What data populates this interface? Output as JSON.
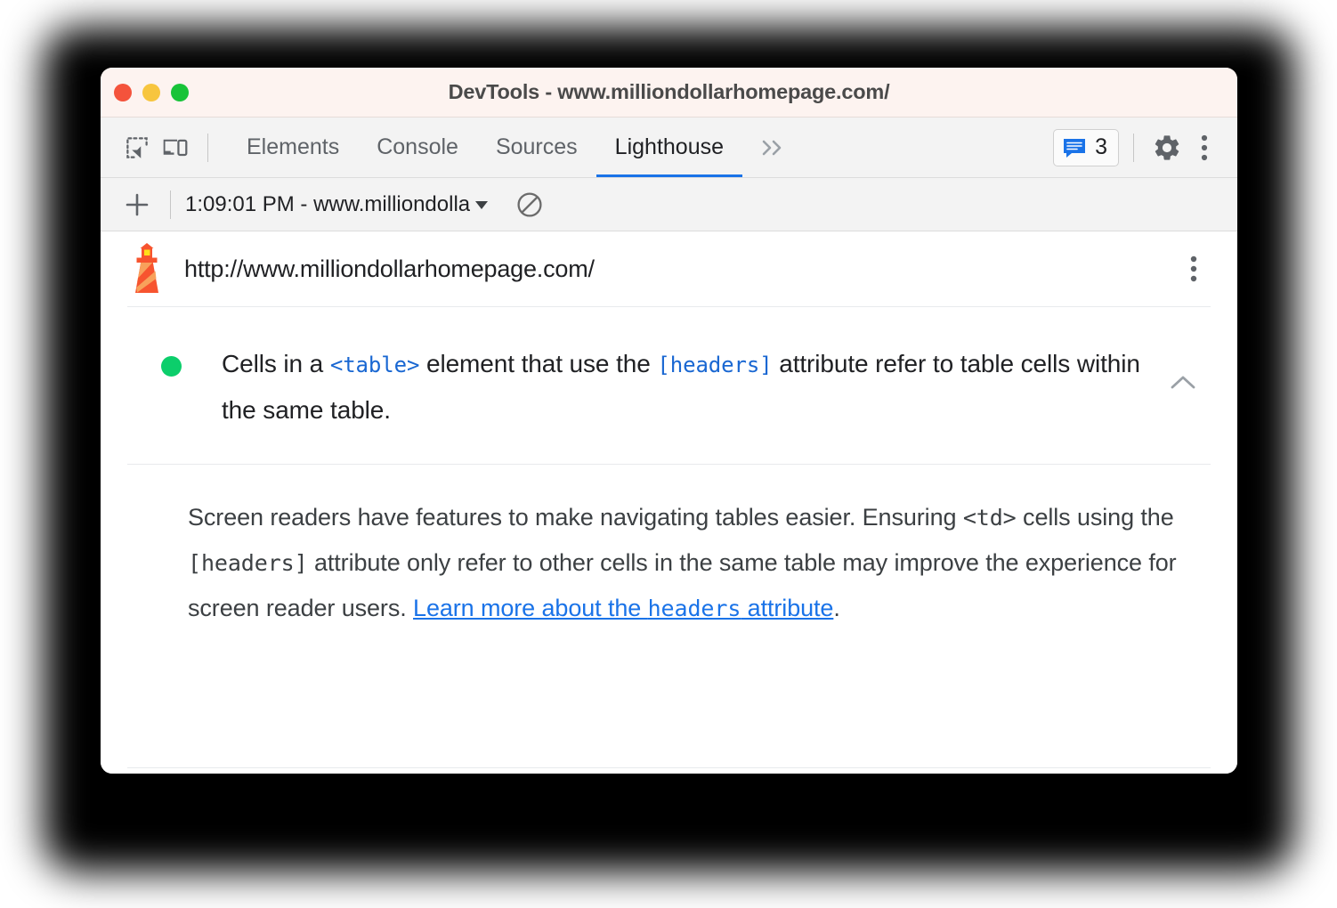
{
  "window": {
    "title": "DevTools - www.milliondollarhomepage.com/",
    "traffic_lights": [
      {
        "name": "close",
        "color": "#f4533c"
      },
      {
        "name": "minimize",
        "color": "#f7c53f"
      },
      {
        "name": "maximize",
        "color": "#18c339"
      }
    ]
  },
  "toolbar": {
    "inspect_icon": "inspect-element-icon",
    "device_icon": "device-toolbar-icon",
    "tabs": [
      {
        "label": "Elements",
        "active": false
      },
      {
        "label": "Console",
        "active": false
      },
      {
        "label": "Sources",
        "active": false
      },
      {
        "label": "Lighthouse",
        "active": true
      }
    ],
    "more_tabs_icon": "chevron-double-right-icon",
    "issues": {
      "icon": "issues-message-icon",
      "count": "3",
      "color": "#1a73e8"
    },
    "settings_icon": "gear-icon",
    "menu_icon": "kebab-menu-icon"
  },
  "runbar": {
    "add_icon": "plus-icon",
    "run_label": "1:09:01 PM - www.milliondolla",
    "caret_icon": "caret-down-icon",
    "clear_icon": "no-entry-clear-icon"
  },
  "report_header": {
    "logo_icon": "lighthouse-icon",
    "url": "http://www.milliondollarhomepage.com/",
    "menu_icon": "kebab-menu-icon"
  },
  "audit": {
    "score_color": "#0cce6b",
    "score_state": "pass",
    "title_parts": [
      {
        "type": "text",
        "value": "Cells in a "
      },
      {
        "type": "code",
        "value": "<table>"
      },
      {
        "type": "text",
        "value": " element that use the "
      },
      {
        "type": "code",
        "value": "[headers]"
      },
      {
        "type": "text",
        "value": " attribute refer to table cells within the same table."
      }
    ],
    "collapse_icon": "chevron-up-icon",
    "description_parts": [
      {
        "type": "text",
        "value": "Screen readers have features to make navigating tables easier. Ensuring "
      },
      {
        "type": "code",
        "value": "<td>"
      },
      {
        "type": "text",
        "value": " cells using the "
      },
      {
        "type": "code",
        "value": "[headers]"
      },
      {
        "type": "text",
        "value": " attribute only refer to other cells in the same table may improve the experience for screen reader users. "
      },
      {
        "type": "link",
        "value": "Learn more about the ",
        "code": "headers",
        "tail": " attribute"
      },
      {
        "type": "text",
        "value": "."
      }
    ]
  },
  "text": {
    "tab_elements": "Elements",
    "tab_console": "Console",
    "tab_sources": "Sources",
    "tab_lighthouse": "Lighthouse",
    "issues_count": "3",
    "run_label": "1:09:01 PM - www.milliondolla",
    "report_url": "http://www.milliondollarhomepage.com/",
    "window_title": "DevTools - www.milliondollarhomepage.com/",
    "title_seg_1": "Cells in a ",
    "title_code_1": "<table>",
    "title_seg_2": " element that use the ",
    "title_code_2": "[headers]",
    "title_seg_3": " attribute refer to table cells within the same table.",
    "desc_seg_1": "Screen readers have features to make navigating tables easier. Ensuring ",
    "desc_code_1": "<td>",
    "desc_seg_2": " cells using the ",
    "desc_code_2": "[headers]",
    "desc_seg_3": " attribute only refer to other cells in the same table may improve the experience for screen reader users. ",
    "link_seg_1": "Learn more about the ",
    "link_code": "headers",
    "link_seg_2": " attribute",
    "desc_seg_4": "."
  }
}
